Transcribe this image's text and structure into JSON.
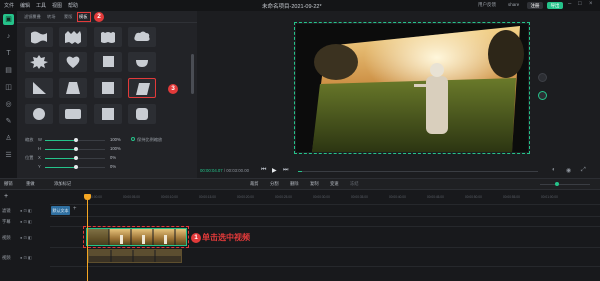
{
  "menu": [
    "文件",
    "编辑",
    "工具",
    "视图",
    "帮助"
  ],
  "window_title": "未命名项目-2021-09-22*",
  "header_buttons": {
    "feedback": "用户反馈",
    "user": "share",
    "register": "注册",
    "export": "导出"
  },
  "tabs": [
    "滤镜覆叠",
    "转场",
    "蒙版",
    "模板"
  ],
  "step_badges": {
    "tab": "2",
    "shape": "3",
    "clip": "1"
  },
  "sliders": [
    {
      "label": "缩放",
      "axis": "W",
      "value": "100%",
      "level": 1.0
    },
    {
      "label": "",
      "axis": "H",
      "value": "100%",
      "level": 1.0
    },
    {
      "label": "位置",
      "axis": "X",
      "value": "0%",
      "level": 0.0
    },
    {
      "label": "",
      "axis": "Y",
      "value": "0%",
      "level": 0.0
    }
  ],
  "keep_ratio_label": "保持比例缩放",
  "timecode": {
    "current": "00:00:04.07",
    "total": "00:03:00.00"
  },
  "toolbar": {
    "left": [
      "撤销",
      "重做"
    ],
    "marker": "添加标记",
    "actions": [
      "裁剪",
      "分割",
      "删除",
      "复制",
      "变速",
      "冻结"
    ]
  },
  "ruler": [
    "00:00:00.00",
    "00:00:05.00",
    "00:00:10.00",
    "00:00:15.00",
    "00:00:20.00",
    "00:00:25.00",
    "00:00:30.00",
    "00:00:35.00",
    "00:00:40.00",
    "00:00:45.00",
    "00:00:50.00",
    "00:00:55.00",
    "00:01:00.00"
  ],
  "tracks": [
    "滤镜",
    "字幕",
    "视频",
    "视频"
  ],
  "text_clip": "默认文本",
  "annotation": "单击选中视频",
  "colors": {
    "accent": "#25c38a",
    "annotation_red": "#e23a3a",
    "playhead": "#f5a623"
  }
}
